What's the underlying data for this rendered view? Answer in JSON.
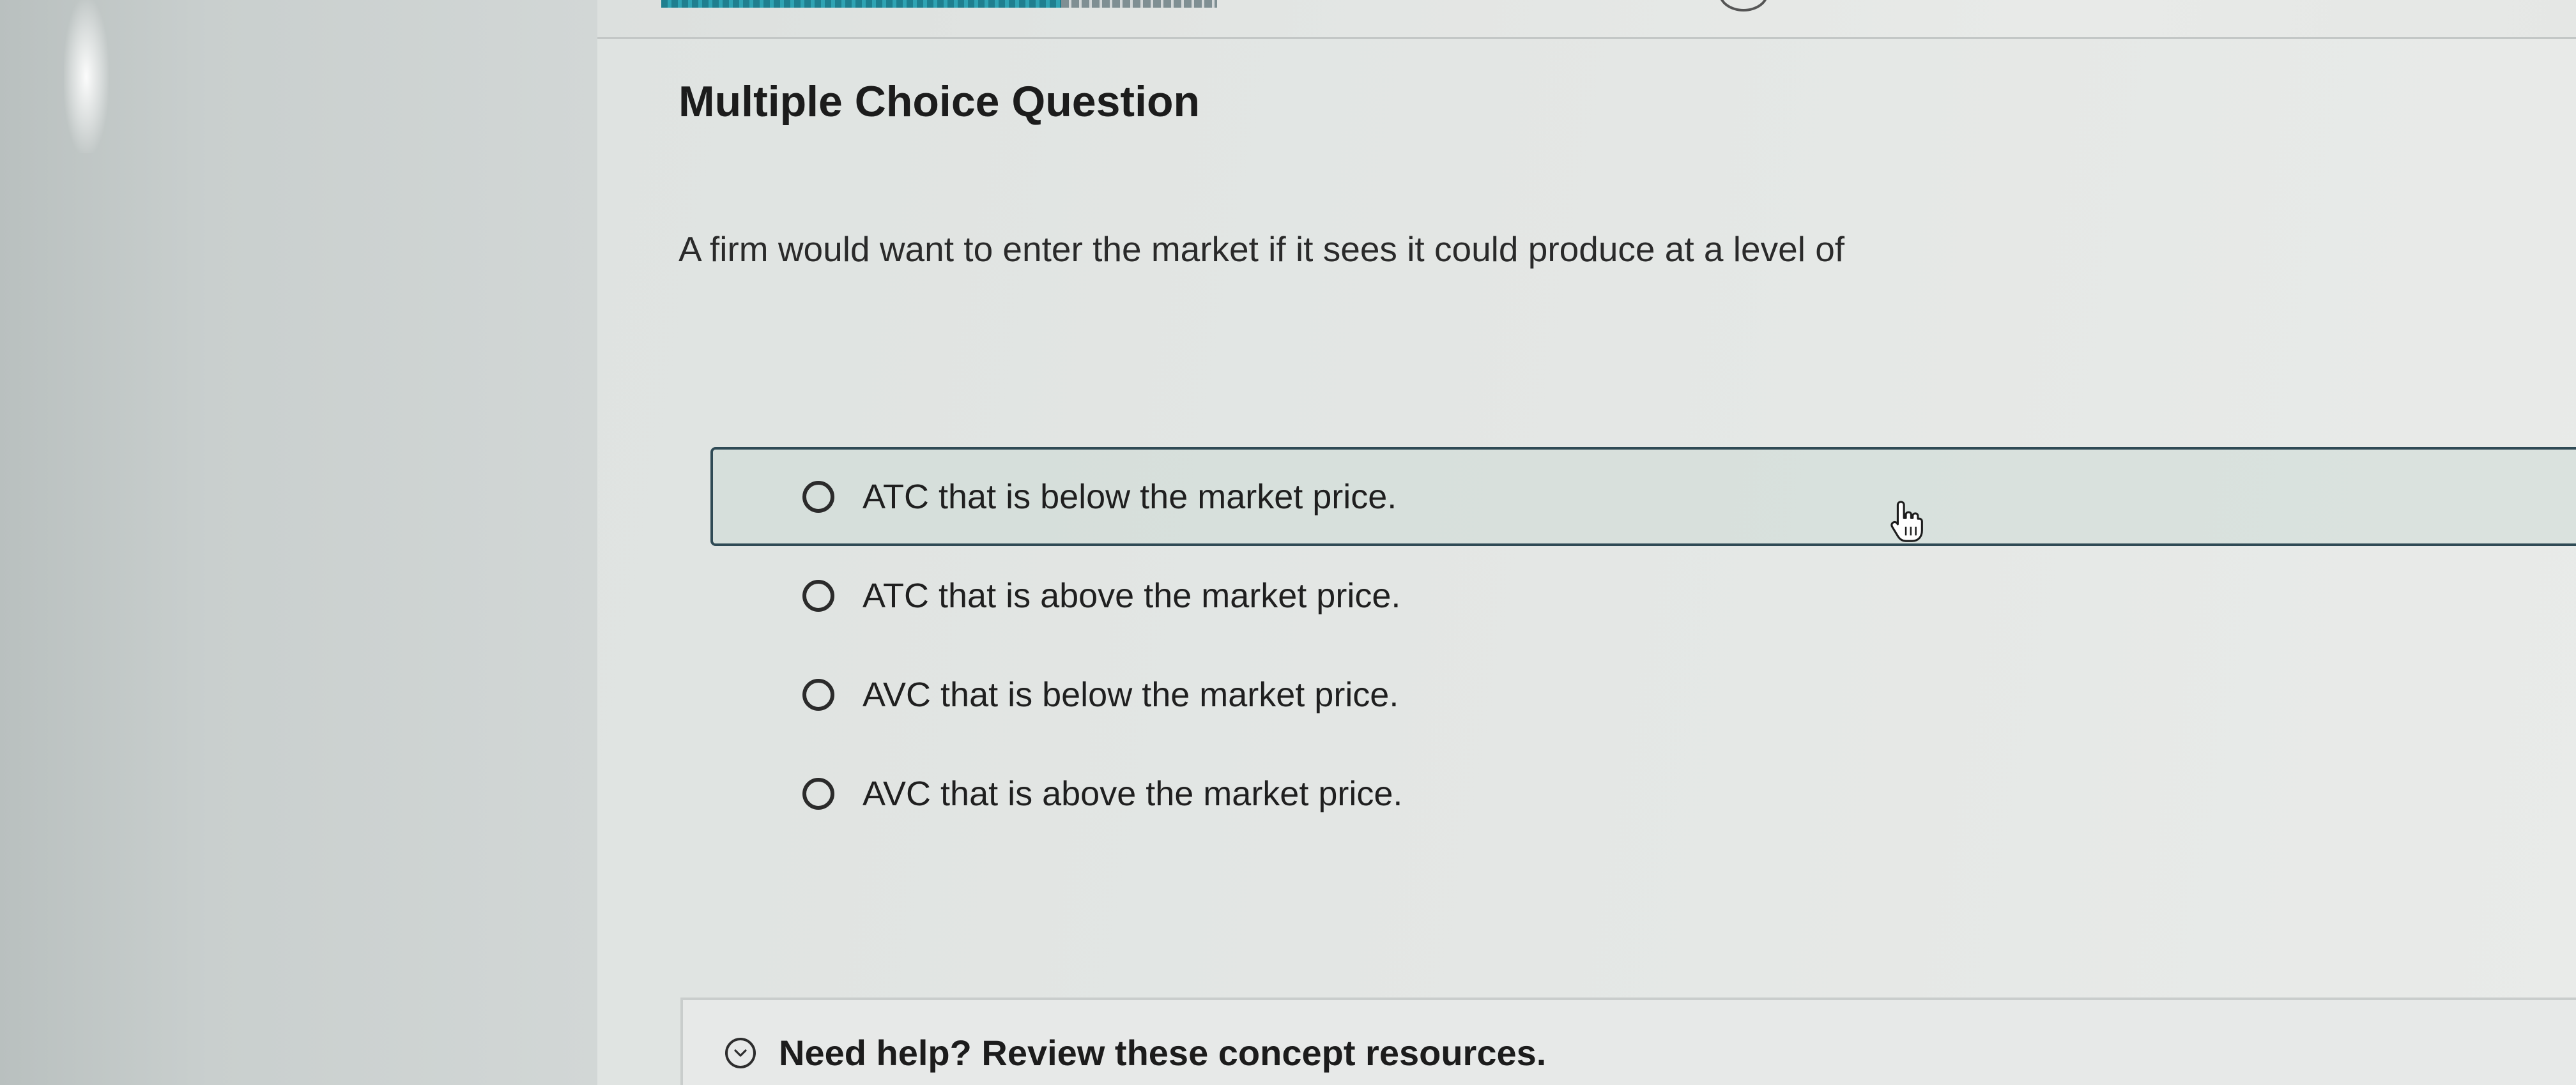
{
  "page": {
    "title": "Multiple Choice Question",
    "question": "A firm would want to enter the market if it sees it could produce at a level of"
  },
  "progress": {
    "completed_fraction": 0.72
  },
  "options": [
    {
      "label": "ATC that is below the market price.",
      "selected": false,
      "hovered": true
    },
    {
      "label": "ATC that is above the market price.",
      "selected": false,
      "hovered": false
    },
    {
      "label": "AVC that is below the market price.",
      "selected": false,
      "hovered": false
    },
    {
      "label": "AVC that is above the market price.",
      "selected": false,
      "hovered": false
    }
  ],
  "help": {
    "label": "Need help? Review these concept resources.",
    "icon": "chevron-down-circle-icon"
  },
  "cursor": {
    "icon": "hand-pointer-icon"
  },
  "colors": {
    "accent": "#1f7f8f",
    "hover_border": "#2f4a55",
    "text": "#1c1c1c"
  }
}
